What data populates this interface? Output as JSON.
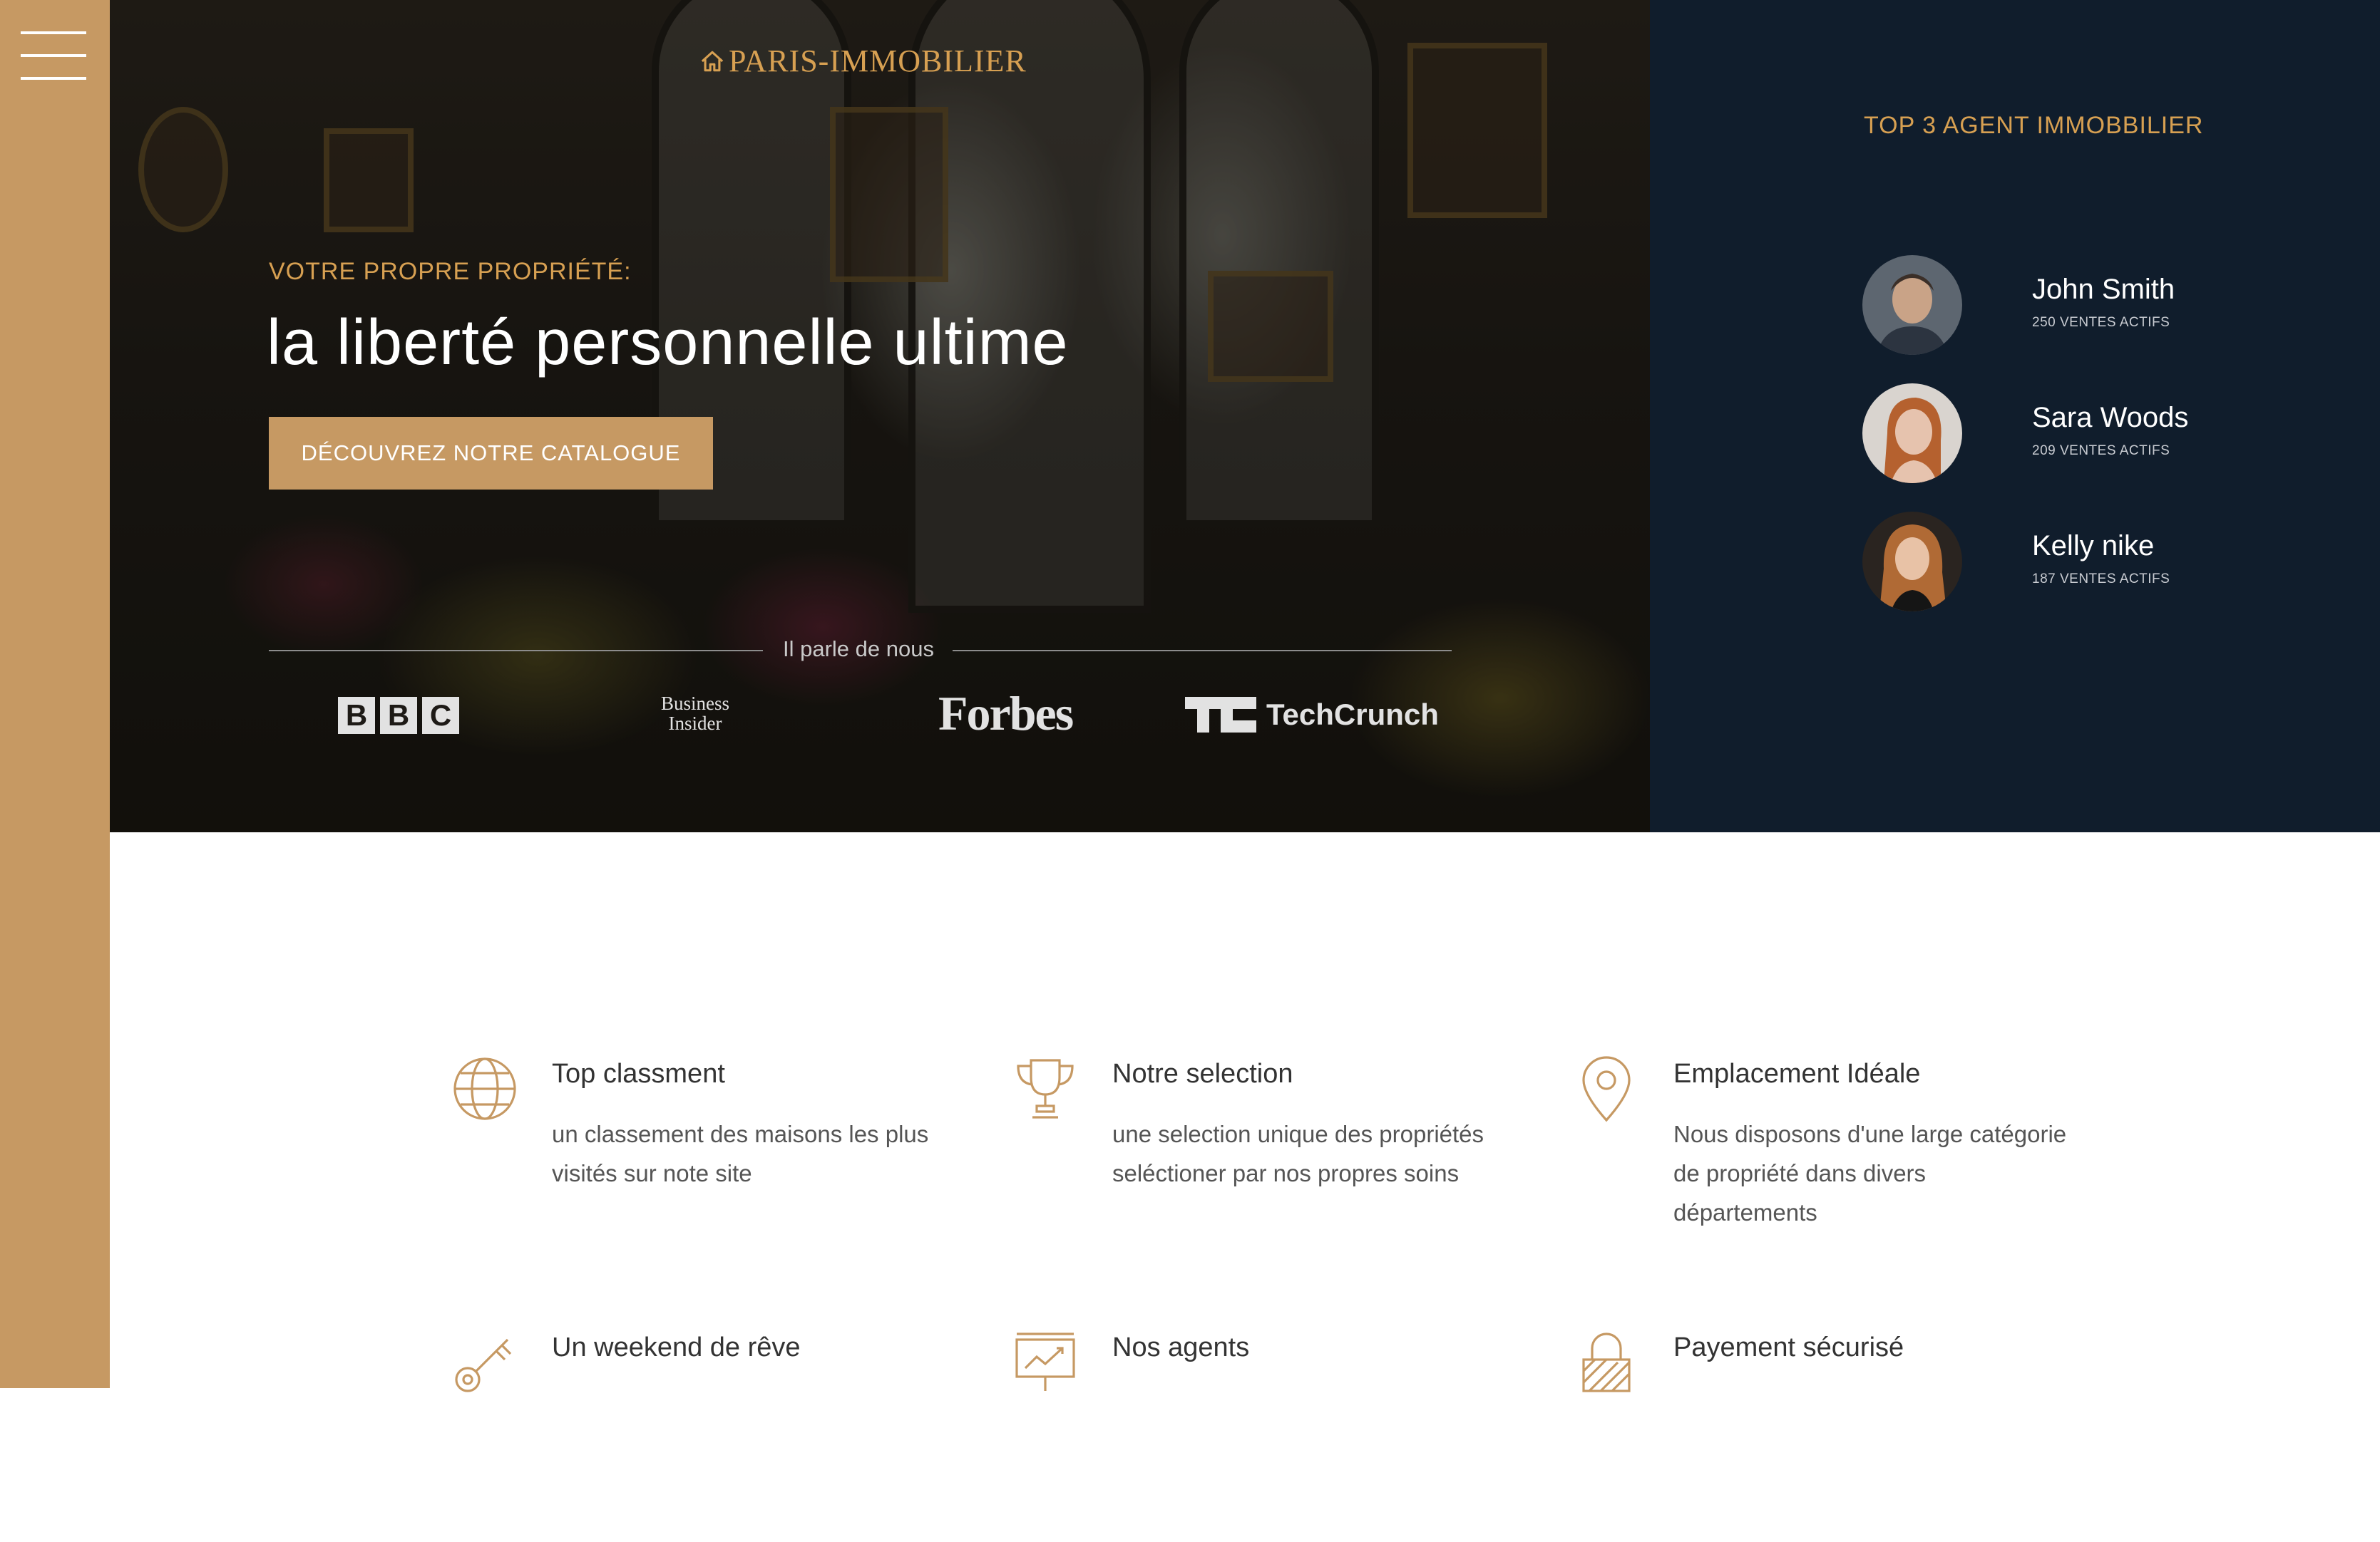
{
  "brand": {
    "name": "PARIS-IMMOBILIER",
    "accent_color": "#c69963",
    "dark_color": "#101d2c"
  },
  "hero": {
    "eyebrow": "VOTRE PROPRE PROPRIÉTÉ:",
    "headline": "la liberté personnelle ultime",
    "cta_label": "DÉCOUVREZ NOTRE CATALOGUE",
    "press_label": "Il parle de nous",
    "press_logos": [
      "BBC",
      "BUSINESS INSIDER",
      "Forbes",
      "TechCrunch"
    ]
  },
  "agents": {
    "title": "TOP 3 AGENT IMMOBBILIER",
    "items": [
      {
        "name": "John Smith",
        "sales": "250 VENTES ACTIFS"
      },
      {
        "name": "Sara Woods",
        "sales": "209 VENTES ACTIFS"
      },
      {
        "name": "Kelly nike",
        "sales": "187 VENTES ACTIFS"
      }
    ]
  },
  "features": [
    {
      "icon": "globe-icon",
      "title": "Top classment",
      "desc": "un classement des maisons les plus visités sur note site"
    },
    {
      "icon": "trophy-icon",
      "title": "Notre selection",
      "desc": "une selection unique des propriétés seléctioner par nos propres soins"
    },
    {
      "icon": "map-pin-icon",
      "title": "Emplacement Idéale",
      "desc": "Nous disposons d'une large catégorie de propriété dans divers départements"
    },
    {
      "icon": "key-icon",
      "title": "Un weekend de rêve",
      "desc": ""
    },
    {
      "icon": "presentation-chart-icon",
      "title": "Nos agents",
      "desc": ""
    },
    {
      "icon": "padlock-icon",
      "title": "Payement sécurisé",
      "desc": ""
    }
  ]
}
